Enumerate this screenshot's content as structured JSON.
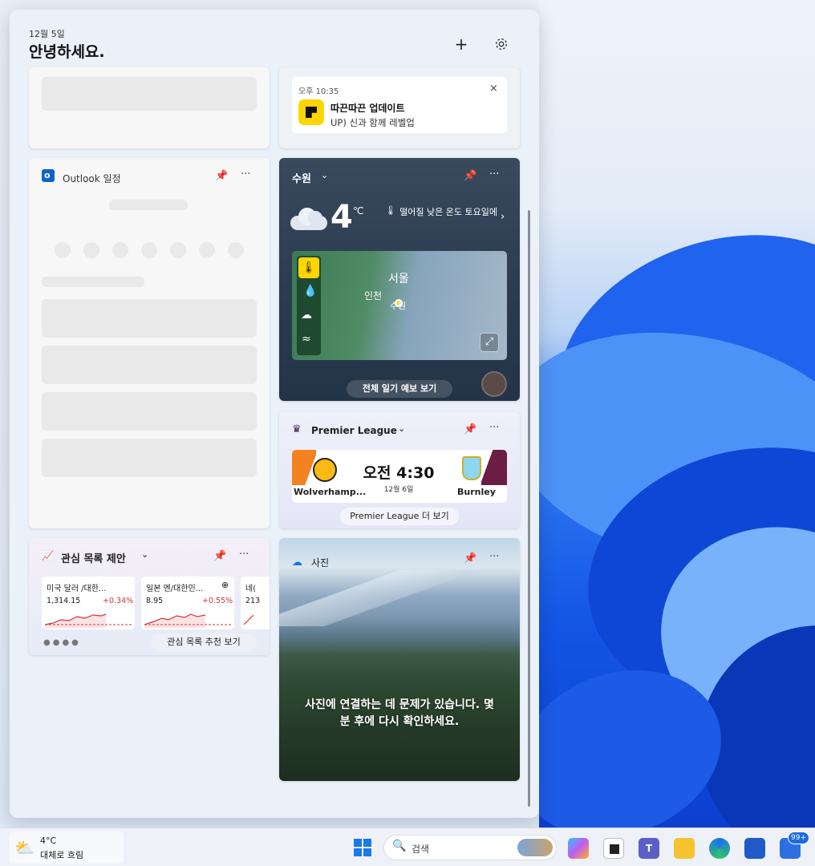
{
  "header": {
    "date": "12월 5일",
    "greeting": "안녕하세요."
  },
  "notification": {
    "time": "오후 10:35",
    "title": "따끈따끈 업데이트",
    "body": "UP) 신과 함께 레벨업"
  },
  "outlook": {
    "title": "Outlook 일정"
  },
  "weather": {
    "location": "수원",
    "temperature": "4",
    "unit": "℃",
    "forecast": "떨어질 낮은 온도 토요일에",
    "map_labels": [
      "서울",
      "인천",
      "수원"
    ],
    "forecast_link": "전체 일기 예보 보기"
  },
  "premier_league": {
    "title": "Premier League",
    "home_team": "Wolverhamp...",
    "away_team": "Burnley",
    "time": "오전 4:30",
    "date": "12월 6일",
    "more_link": "Premier League 더 보기"
  },
  "watchlist": {
    "title": "관심 목록 제안",
    "tickers": [
      {
        "name": "미국 달러 /대한...",
        "value": "1,314.15",
        "change": "+0.34%"
      },
      {
        "name": "일본 엔/대한민...",
        "value": "8.95",
        "change": "+0.55%"
      },
      {
        "name": "네(",
        "value": "213",
        "change": ""
      }
    ],
    "link": "관심 목록 추천 보기"
  },
  "photos": {
    "title": "사진",
    "message": "사진에 연결하는 데 문제가 있습니다. 몇 분 후에 다시 확인하세요."
  },
  "taskbar": {
    "weather_temp": "4°C",
    "weather_desc": "대체로 흐림",
    "search_placeholder": "검색",
    "badge": "99+"
  }
}
